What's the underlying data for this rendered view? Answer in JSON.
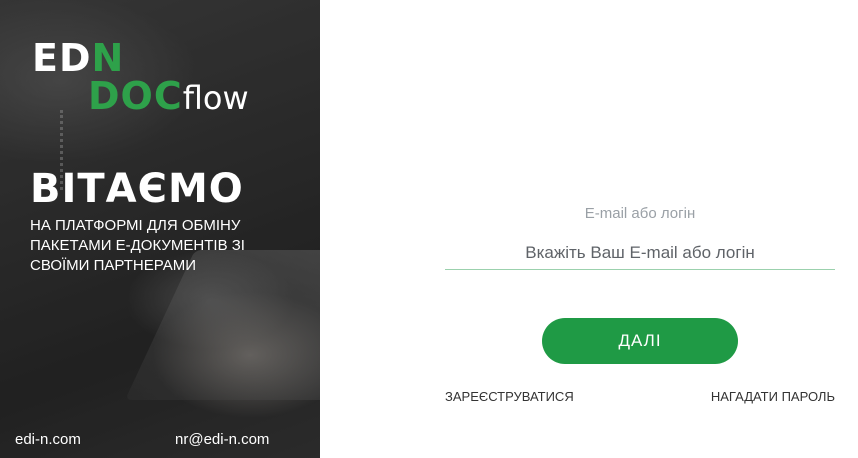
{
  "hero": {
    "logo": {
      "part1_white": "ED",
      "part1_green": "N",
      "part2_green_d": "D",
      "part2_white": "OC",
      "part2_flow": "flow"
    },
    "welcome": "ВІТАЄМО",
    "subtitle": "НА ПЛАТФОРМІ ДЛЯ ОБМІНУ ПАКЕТАМИ Е-ДОКУМЕНТІВ ЗІ СВОЇМИ ПАРТНЕРАМИ",
    "footer": {
      "site": "edi-n.com",
      "email": "nr@edi-n.com"
    }
  },
  "form": {
    "label": "E-mail або логін",
    "input_value": "",
    "input_placeholder": "Вкажіть Ваш E-mail або логін",
    "next_label": "ДАЛІ",
    "register_label": "ЗАРЕЄСТРУВАТИСЯ",
    "forgot_label": "НАГАДАТИ ПАРОЛЬ"
  },
  "colors": {
    "accent_green": "#1f9a45",
    "logo_green": "#2ea14a",
    "input_underline": "#9bd1ad"
  }
}
